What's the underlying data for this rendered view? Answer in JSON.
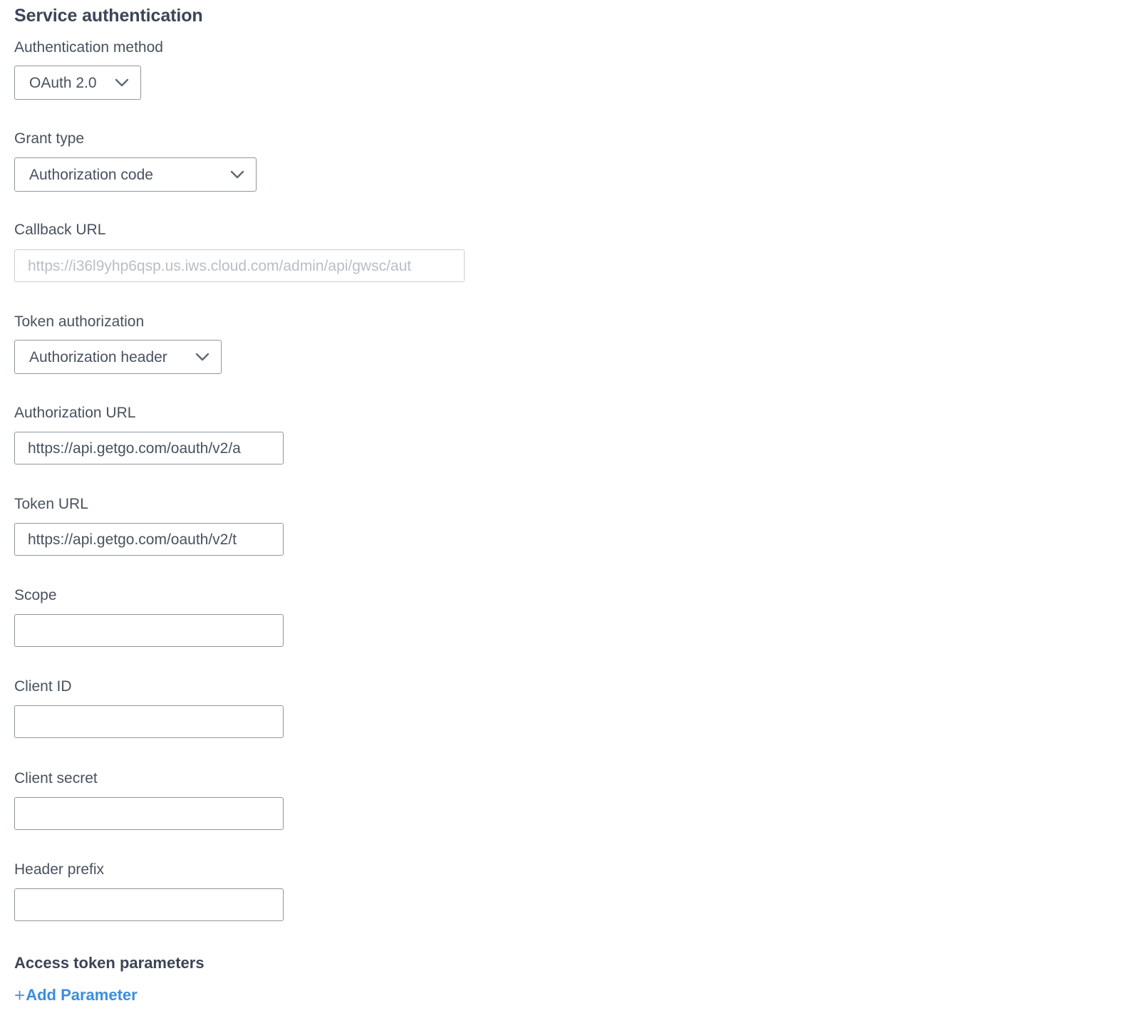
{
  "section": {
    "title": "Service authentication"
  },
  "fields": {
    "auth_method": {
      "label": "Authentication method",
      "value": "OAuth 2.0",
      "icon": "chevron-down-icon"
    },
    "grant_type": {
      "label": "Grant type",
      "value": "Authorization code",
      "icon": "chevron-down-icon"
    },
    "callback_url": {
      "label": "Callback URL",
      "value": "",
      "placeholder": "https://i36l9yhp6qsp.us.iws.cloud.com/admin/api/gwsc/aut"
    },
    "token_authorization": {
      "label": "Token authorization",
      "value": "Authorization header",
      "icon": "chevron-down-icon"
    },
    "authorization_url": {
      "label": "Authorization URL",
      "value": "https://api.getgo.com/oauth/v2/a"
    },
    "token_url": {
      "label": "Token URL",
      "value": "https://api.getgo.com/oauth/v2/t"
    },
    "scope": {
      "label": "Scope",
      "value": ""
    },
    "client_id": {
      "label": "Client ID",
      "value": ""
    },
    "client_secret": {
      "label": "Client secret",
      "value": ""
    },
    "header_prefix": {
      "label": "Header prefix",
      "value": ""
    }
  },
  "access_token_parameters": {
    "title": "Access token parameters",
    "add_plus": "+",
    "add_label": "Add Parameter"
  },
  "colors": {
    "text": "#48515f",
    "heading": "#3b4556",
    "border": "#8f96a0",
    "muted_border": "#c9cdd3",
    "placeholder": "#b9bec6",
    "link": "#3c8dde"
  }
}
